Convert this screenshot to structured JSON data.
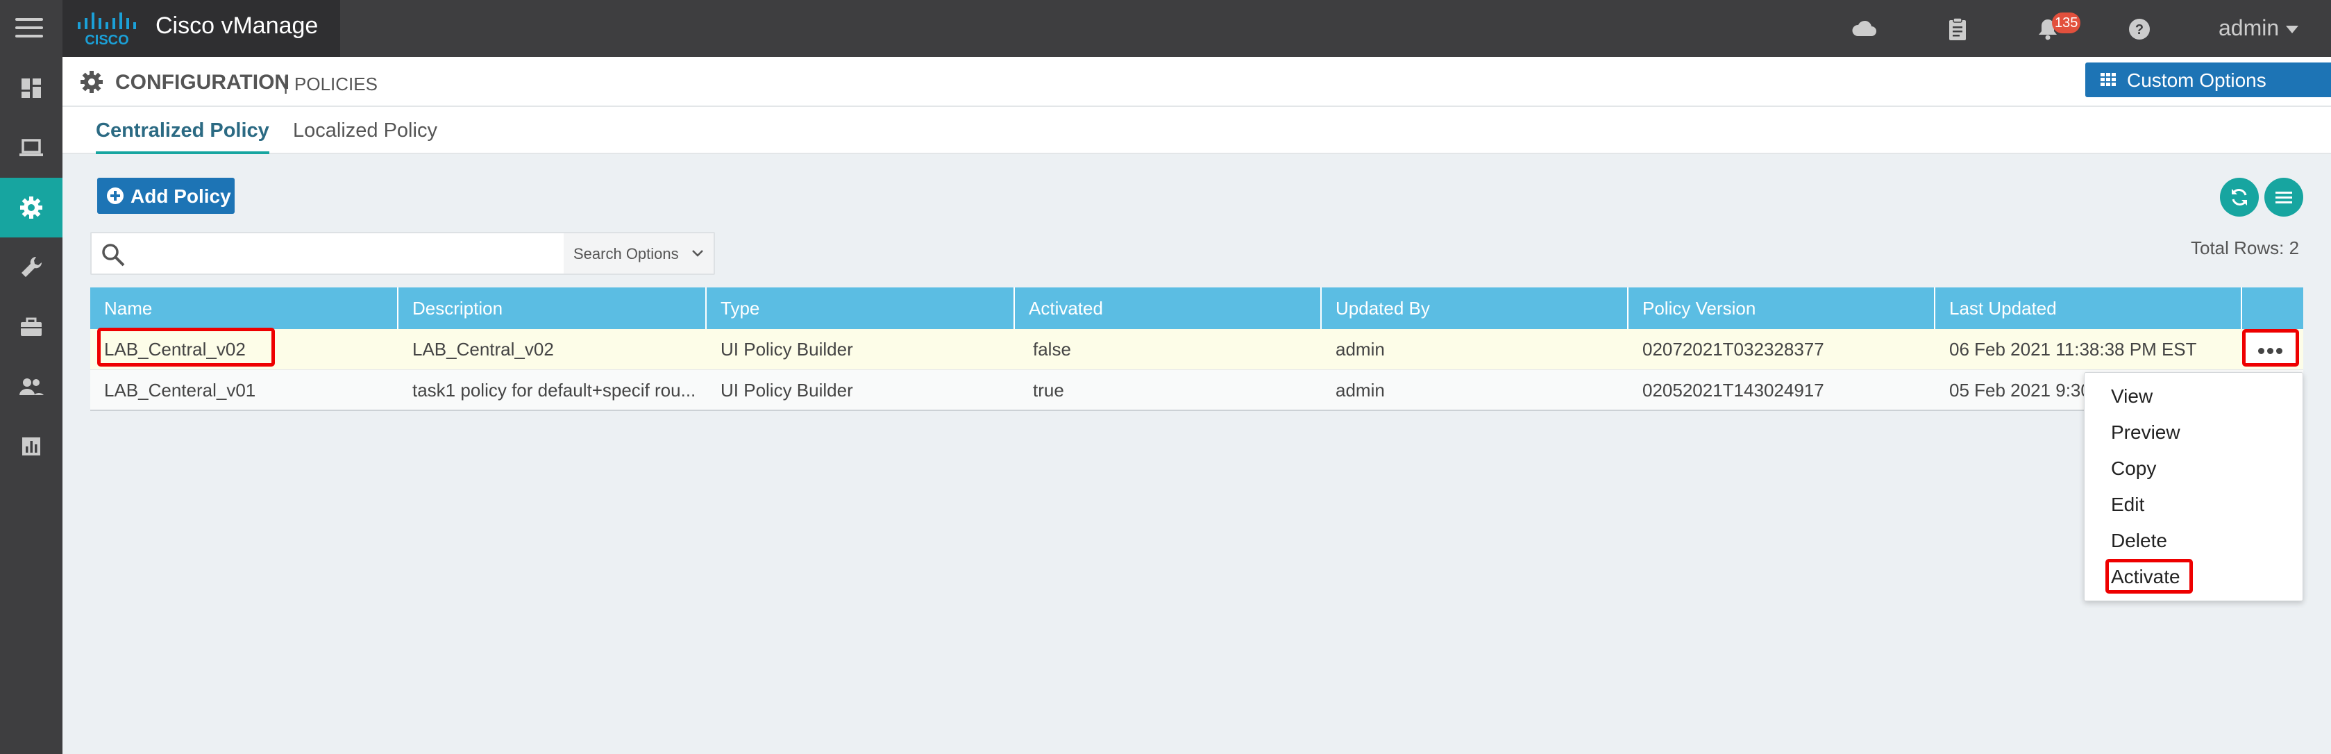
{
  "app": {
    "title": "Cisco vManage"
  },
  "topbar": {
    "notification_count": "135",
    "user": "admin"
  },
  "header": {
    "section": "CONFIGURATION",
    "separator": "|",
    "subsection": "POLICIES",
    "custom_options_label": "Custom Options"
  },
  "tabs": [
    {
      "label": "Centralized Policy",
      "active": true
    },
    {
      "label": "Localized Policy",
      "active": false
    }
  ],
  "toolbar": {
    "add_policy_label": "Add Policy"
  },
  "search": {
    "placeholder": "",
    "options_label": "Search Options"
  },
  "table": {
    "total_rows": "Total Rows: 2",
    "columns": [
      "Name",
      "Description",
      "Type",
      "Activated",
      "Updated By",
      "Policy Version",
      "Last Updated"
    ],
    "rows": [
      {
        "name": "LAB_Central_v02",
        "description": "LAB_Central_v02",
        "type": "UI Policy Builder",
        "activated": "false",
        "updated_by": "admin",
        "policy_version": "02072021T032328377",
        "last_updated": "06 Feb 2021 11:38:38 PM EST"
      },
      {
        "name": "LAB_Centeral_v01",
        "description": "task1 policy for default+specif rou...",
        "type": "UI Policy Builder",
        "activated": "true",
        "updated_by": "admin",
        "policy_version": "02052021T143024917",
        "last_updated": "05 Feb 2021 9:30"
      }
    ]
  },
  "row_menu": {
    "items": [
      "View",
      "Preview",
      "Copy",
      "Edit",
      "Delete",
      "Activate"
    ]
  },
  "colors": {
    "topbar": "#3e3e40",
    "accent_teal": "#17a5a0",
    "button_blue": "#1d74b5",
    "table_header": "#5bbde3",
    "highlight": "#ee0000"
  }
}
